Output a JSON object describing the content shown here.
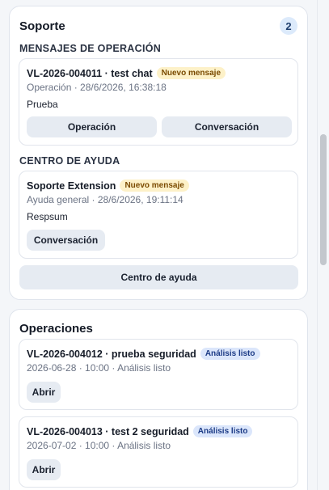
{
  "support": {
    "title": "Soporte",
    "count": "2",
    "ops_messages_label": "MENSAJES DE OPERACIÓN",
    "op_card": {
      "title": "VL-2026-004011 · test chat",
      "badge": "Nuevo mensaje",
      "meta": "Operación · 28/6/2026, 16:38:18",
      "body": "Prueba",
      "btn_operation": "Operación",
      "btn_conversation": "Conversación"
    },
    "help_center_label": "CENTRO DE AYUDA",
    "help_card": {
      "title": "Soporte Extension",
      "badge": "Nuevo mensaje",
      "meta": "Ayuda general · 28/6/2026, 19:11:14",
      "body": "Respsum",
      "btn_conversation": "Conversación"
    },
    "help_center_button": "Centro de ayuda"
  },
  "operations": {
    "title": "Operaciones",
    "items": [
      {
        "title": "VL-2026-004012 · prueba seguridad",
        "badge": "Análisis listo",
        "meta": "2026-06-28 · 10:00 · Análisis listo",
        "btn_open": "Abrir"
      },
      {
        "title": "VL-2026-004013 · test 2 seguridad",
        "badge": "Análisis listo",
        "meta": "2026-07-02 · 10:00 · Análisis listo",
        "btn_open": "Abrir"
      }
    ]
  }
}
